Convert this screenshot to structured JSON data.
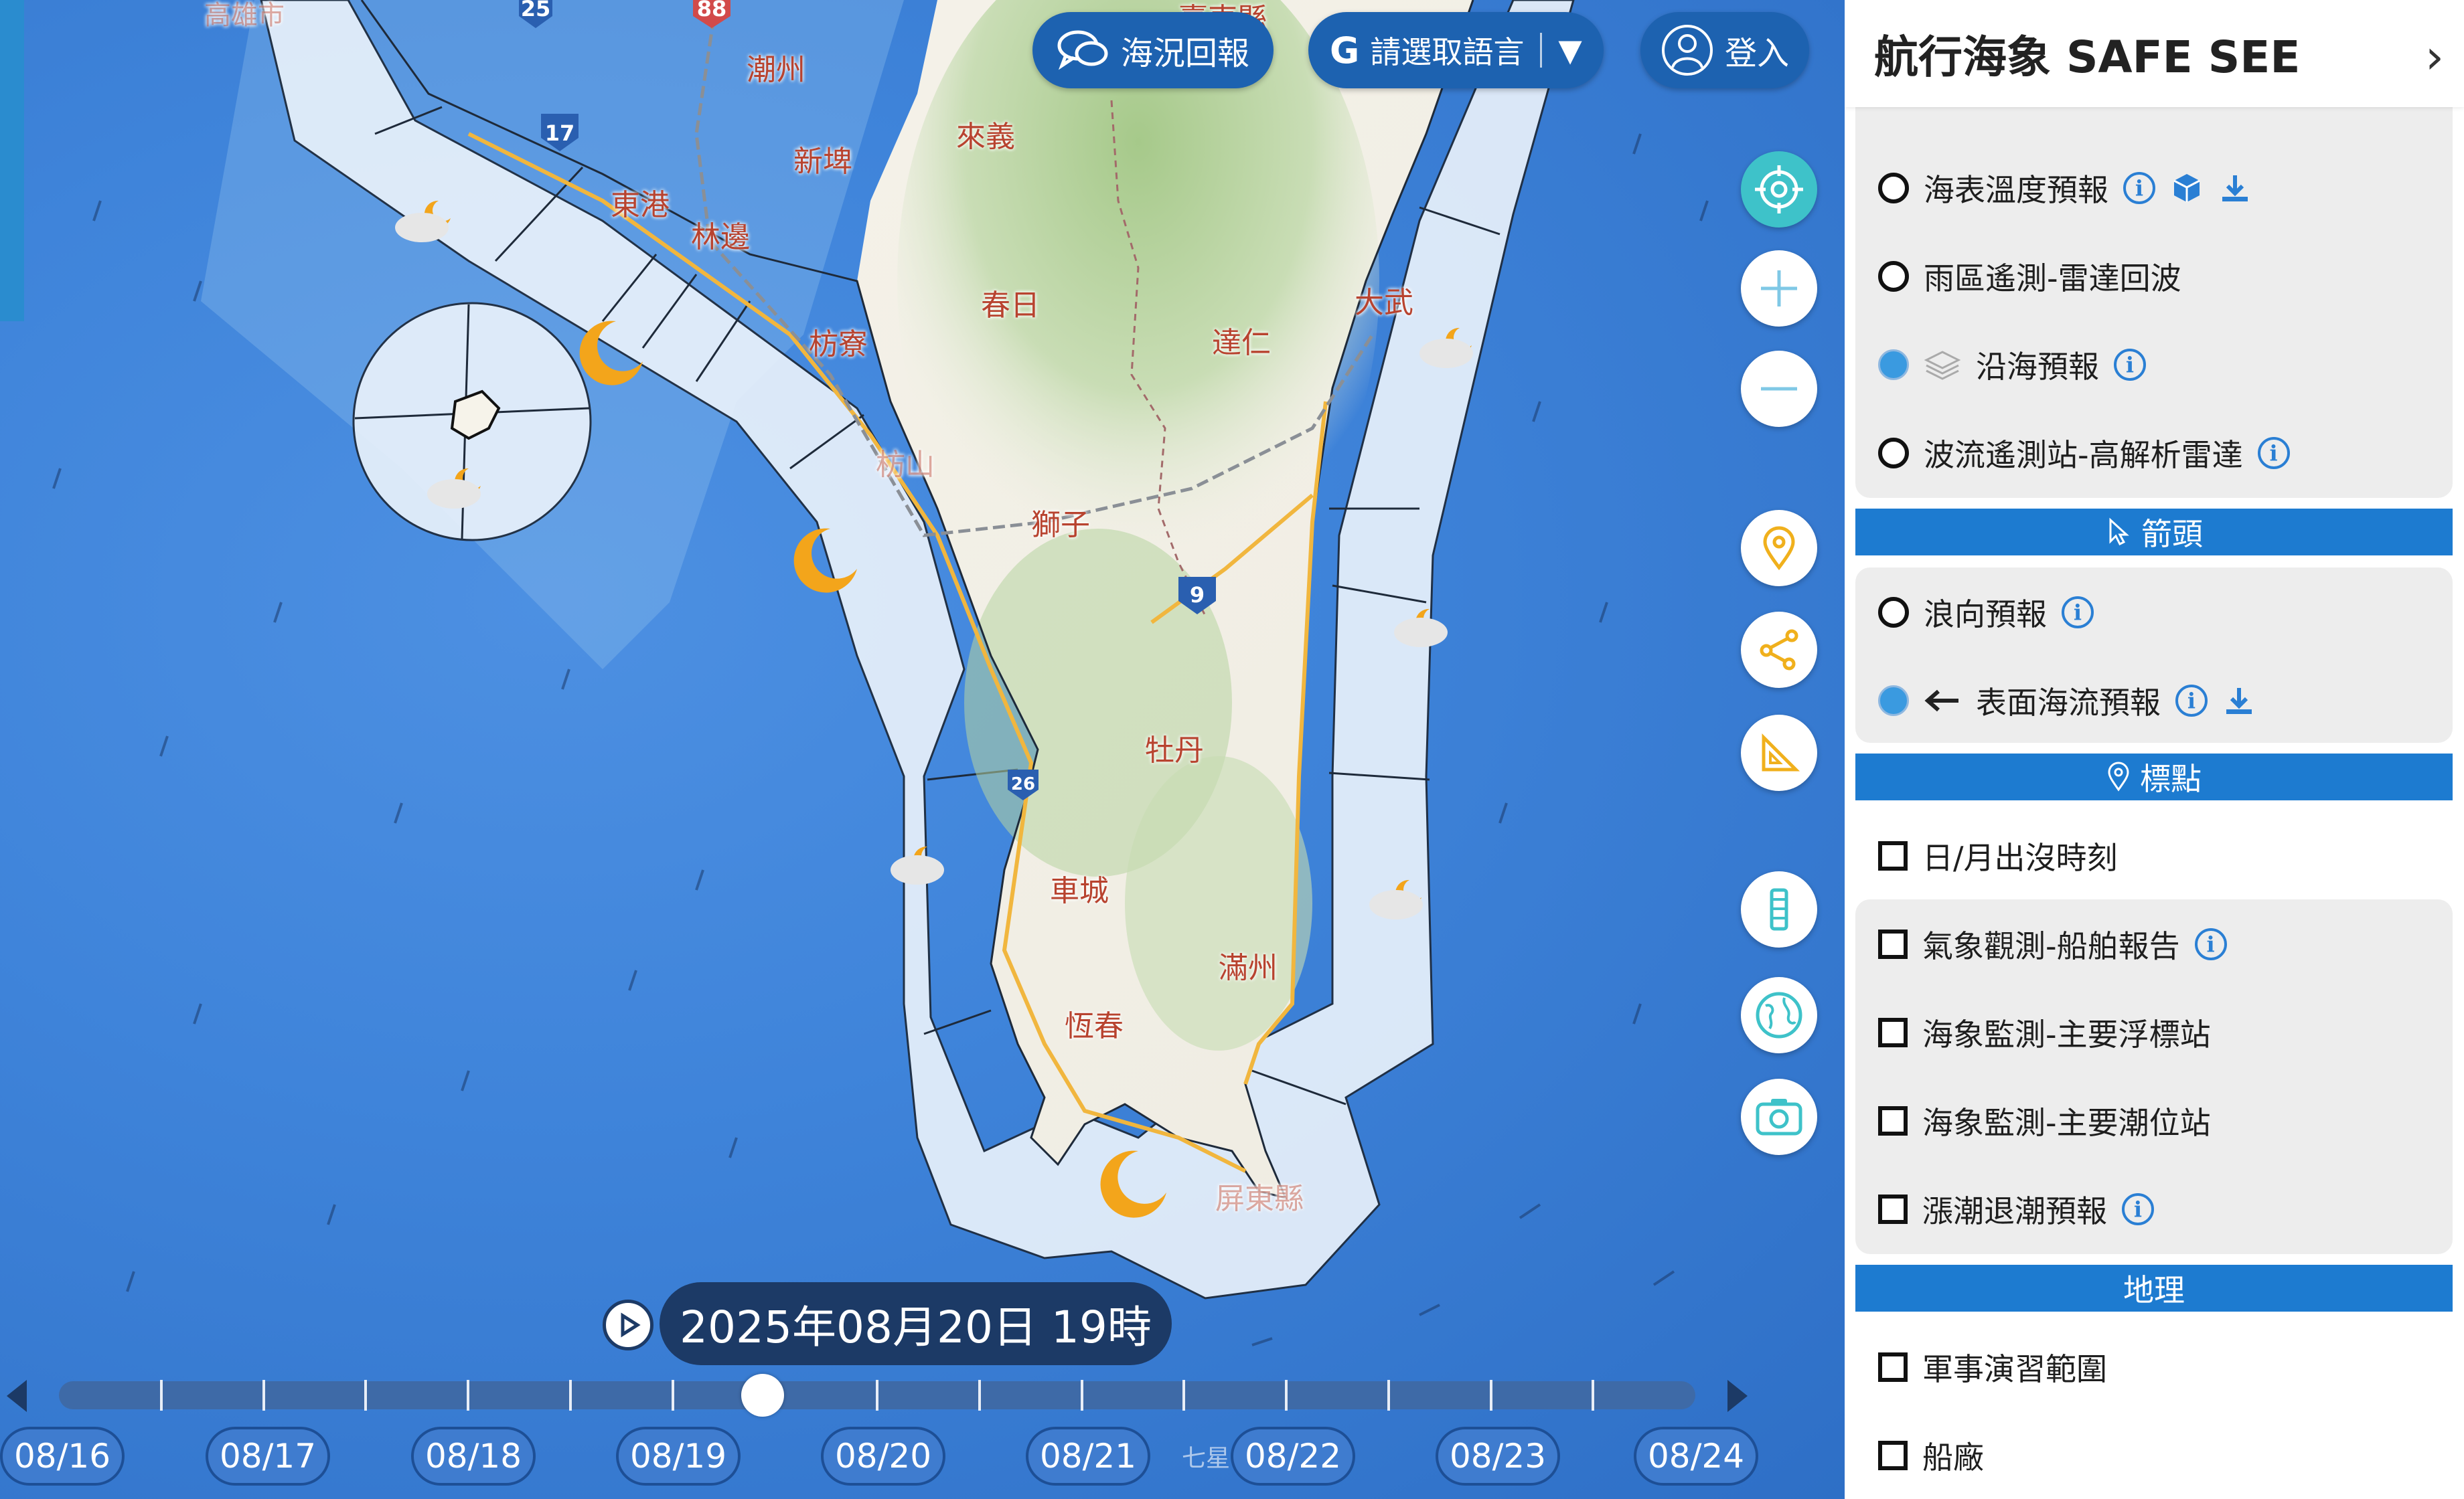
{
  "top_buttons": {
    "report": "海況回報",
    "language": "請選取語言",
    "language_caret": "▼",
    "login": "登入"
  },
  "map_labels": [
    {
      "text": "潮州"
    },
    {
      "text": "新埤"
    },
    {
      "text": "來義"
    },
    {
      "text": "東港"
    },
    {
      "text": "林邊"
    },
    {
      "text": "春日"
    },
    {
      "text": "枋寮"
    },
    {
      "text": "大武"
    },
    {
      "text": "達仁"
    },
    {
      "text": "枋山"
    },
    {
      "text": "獅子"
    },
    {
      "text": "牡丹"
    },
    {
      "text": "車城"
    },
    {
      "text": "滿州"
    },
    {
      "text": "恆春"
    },
    {
      "text": "屏東縣"
    },
    {
      "text": "臺東縣"
    },
    {
      "text": "高雄市"
    },
    {
      "text": "七星"
    }
  ],
  "road_shields": [
    "25",
    "88",
    "17",
    "9",
    "26"
  ],
  "timeline": {
    "current": "2025年08月20日 19時",
    "dates": [
      "08/16",
      "08/17",
      "08/18",
      "08/19",
      "08/20",
      "08/21",
      "08/22",
      "08/23",
      "08/24"
    ],
    "position_fraction": 0.43
  },
  "panel": {
    "title": "航行海象 SAFE SEE",
    "close": "›",
    "layers_top": [
      {
        "label": "海表溫度預報",
        "state": "off",
        "info": true,
        "cube": true,
        "download": true
      },
      {
        "label": "雨區遙測-雷達回波",
        "state": "off"
      },
      {
        "label": "沿海預報",
        "state": "on",
        "info": true,
        "stack": true
      },
      {
        "label": "波流遙測站-高解析雷達",
        "state": "off",
        "info": true
      }
    ],
    "section_arrow": "箭頭",
    "arrow_layers": [
      {
        "label": "浪向預報",
        "state": "off",
        "info": true
      },
      {
        "label": "表面海流預報",
        "state": "on",
        "info": true,
        "download": true
      }
    ],
    "section_points": "標點",
    "point_layers": [
      {
        "label": "日/月出沒時刻"
      },
      {
        "label": "氣象觀測-船舶報告",
        "info": true
      },
      {
        "label": "海象監測-主要浮標站"
      },
      {
        "label": "海象監測-主要潮位站"
      },
      {
        "label": "漲潮退潮預報",
        "info": true
      }
    ],
    "section_geo": "地理",
    "geo_layers": [
      {
        "label": "軍事演習範圍"
      },
      {
        "label": "船廠"
      }
    ]
  },
  "colors": {
    "sea": "#3f84da",
    "panel_section": "#1d7bd0",
    "active_radio": "#3a9ae0",
    "map_button": "#1d62b0",
    "place_label": "#b8432f"
  }
}
